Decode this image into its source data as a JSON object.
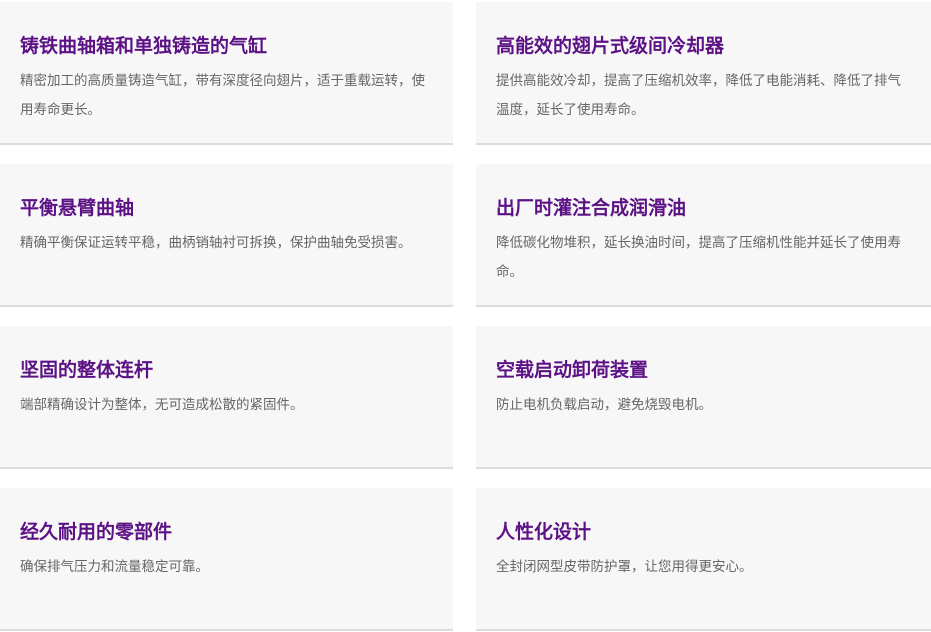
{
  "features": [
    {
      "title": "铸铁曲轴箱和单独铸造的气缸",
      "desc": "精密加工的高质量铸造气缸，带有深度径向翅片，适于重载运转，使用寿命更长。"
    },
    {
      "title": "高能效的翅片式级间冷却器",
      "desc": "提供高能效冷却，提高了压缩机效率，降低了电能消耗、降低了排气温度，延长了使用寿命。"
    },
    {
      "title": "平衡悬臂曲轴",
      "desc": "精确平衡保证运转平稳，曲柄销轴衬可拆换，保护曲轴免受损害。"
    },
    {
      "title": "出厂时灌注合成润滑油",
      "desc": "降低碳化物堆积，延长换油时间，提高了压缩机性能并延长了使用寿命。"
    },
    {
      "title": "坚固的整体连杆",
      "desc": "端部精确设计为整体，无可造成松散的紧固件。"
    },
    {
      "title": "空载启动卸荷装置",
      "desc": "防止电机负载启动，避免烧毁电机。"
    },
    {
      "title": "经久耐用的零部件",
      "desc": "确保排气压力和流量稳定可靠。"
    },
    {
      "title": "人性化设计",
      "desc": "全封闭网型皮带防护罩，让您用得更安心。"
    }
  ],
  "colors": {
    "title": "#5c1285",
    "description": "#666666",
    "card_background": "#f7f7f7",
    "card_border": "#dcdcdc"
  }
}
